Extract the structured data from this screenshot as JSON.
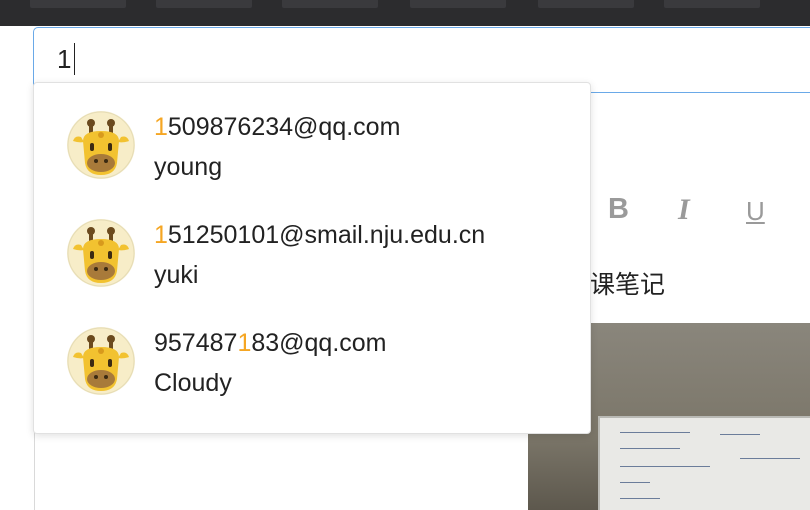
{
  "search": {
    "value": "1"
  },
  "editor": {
    "bold_label": "B",
    "italic_label": "I",
    "underline_label": "U",
    "note_title": "课笔记"
  },
  "suggestions": [
    {
      "email_before": "",
      "email_match": "1",
      "email_after": "509876234@qq.com",
      "name": "young",
      "avatar_icon": "giraffe-avatar-icon"
    },
    {
      "email_before": "",
      "email_match": "1",
      "email_after": "51250101@smail.nju.edu.cn",
      "name": "yuki",
      "avatar_icon": "giraffe-avatar-icon"
    },
    {
      "email_before": "957487",
      "email_match": "1",
      "email_after": "83@qq.com",
      "name": "Cloudy",
      "avatar_icon": "giraffe-avatar-icon"
    }
  ],
  "colors": {
    "match_highlight": "#f5a623",
    "focus_border": "#6aa9e8",
    "topbar": "#2c2c2e"
  }
}
